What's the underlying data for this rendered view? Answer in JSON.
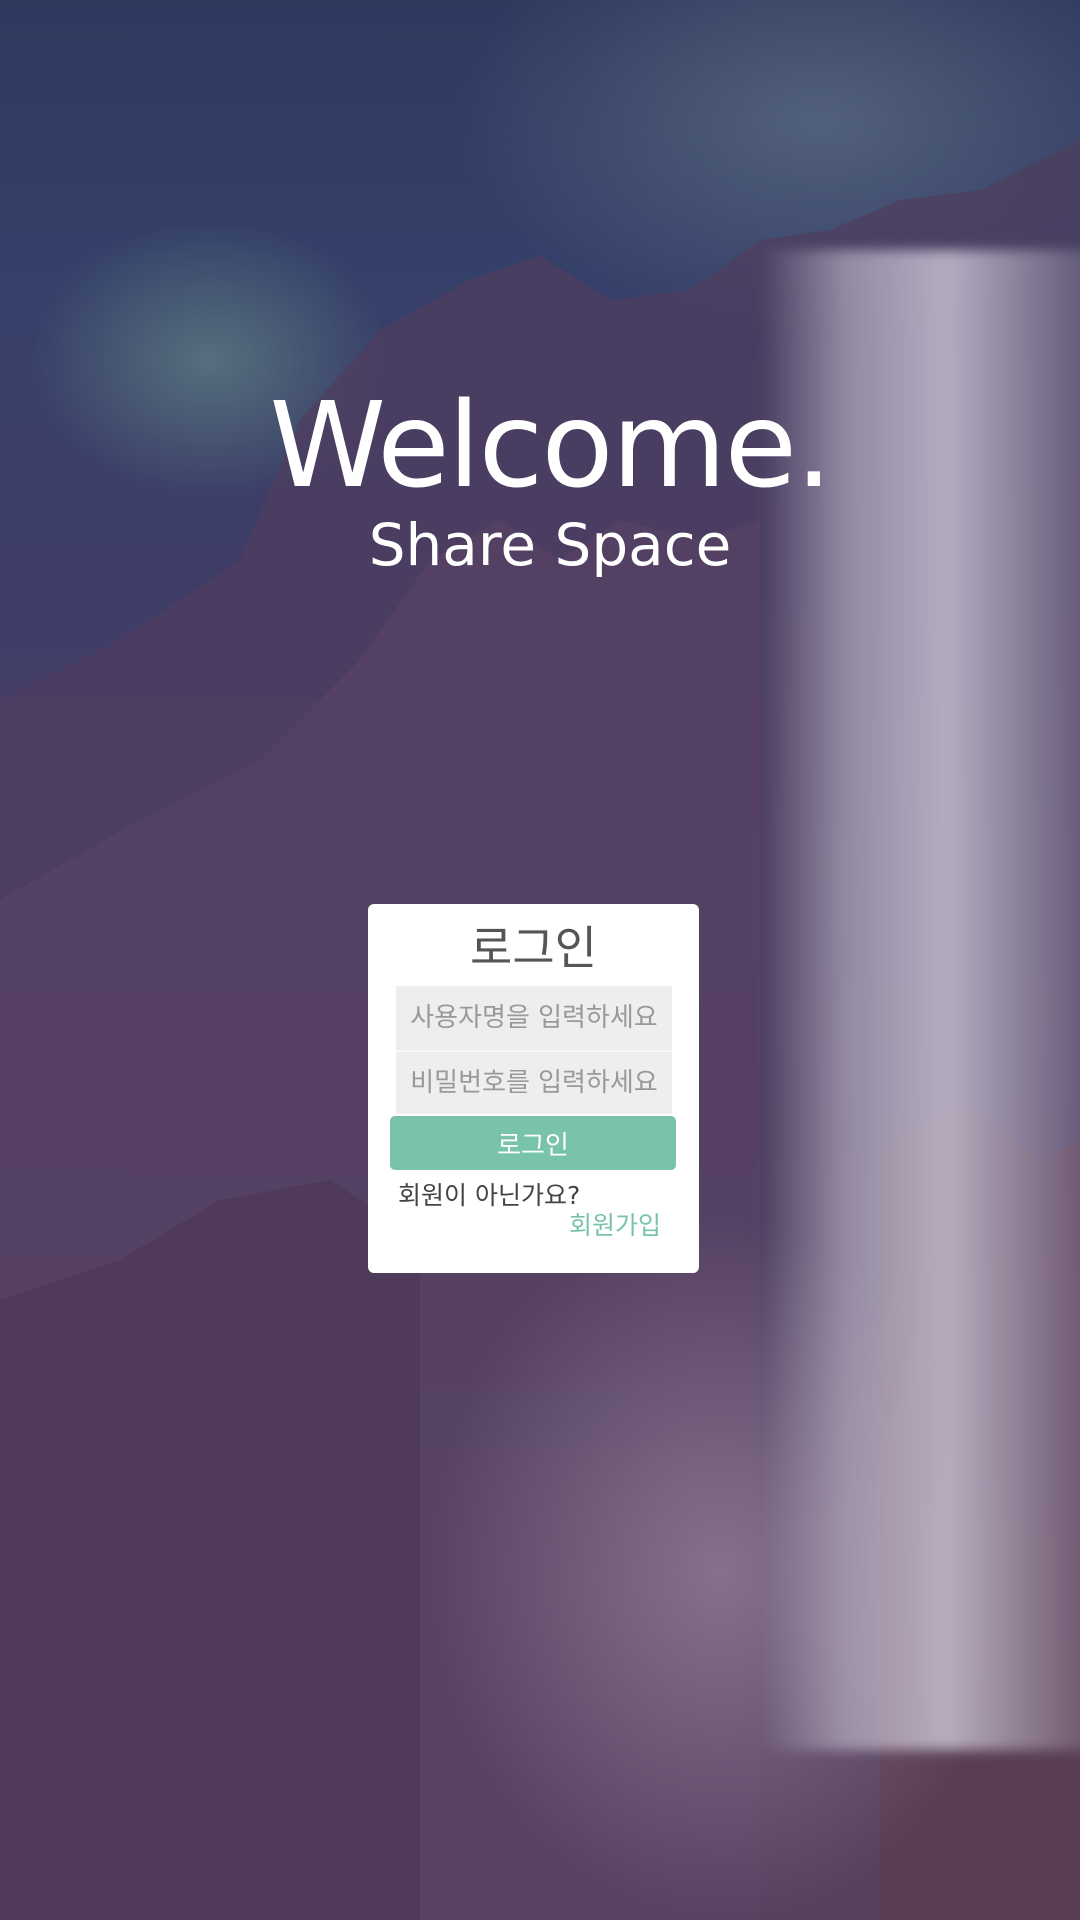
{
  "hero": {
    "title": "Welcome.",
    "subtitle": "Share Space"
  },
  "login": {
    "title": "로그인",
    "username_placeholder": "사용자명을 입력하세요",
    "password_placeholder": "비밀번호를 입력하세요",
    "submit_label": "로그인",
    "signup_prompt": "회원이 아닌가요?",
    "signup_link": "회원가입"
  },
  "colors": {
    "accent": "#79c3ab",
    "card_background": "#ffffff",
    "input_background": "#eeeeee"
  }
}
